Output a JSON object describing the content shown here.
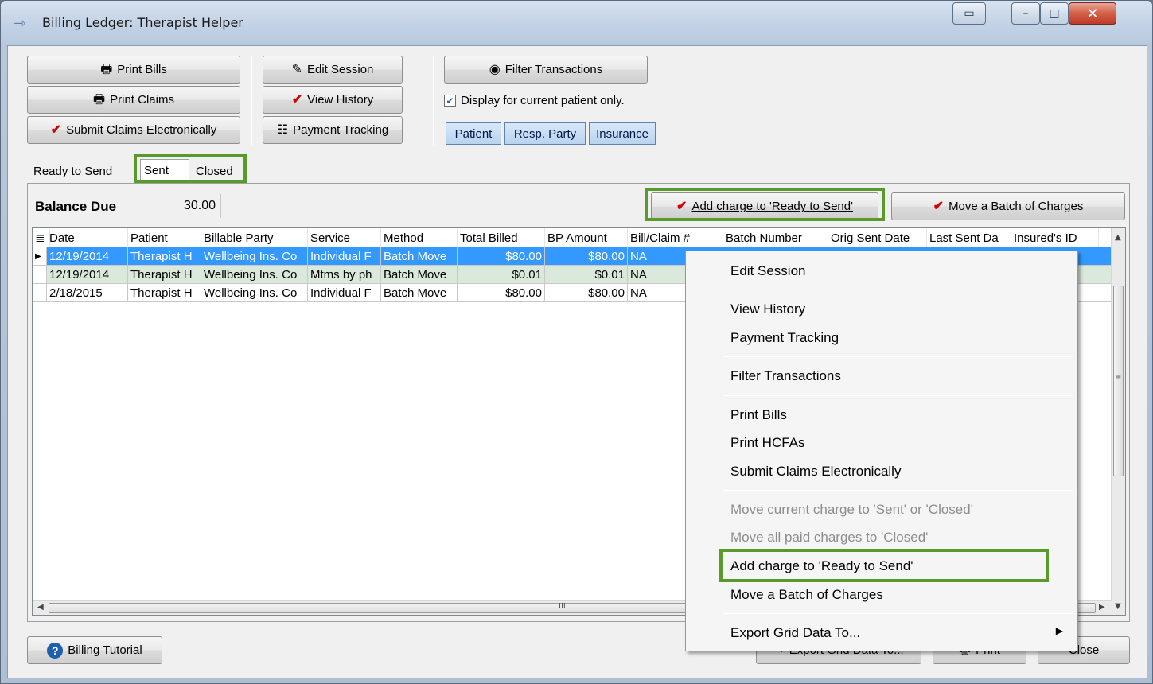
{
  "window": {
    "title": "Billing Ledger: Therapist Helper"
  },
  "toolbar": {
    "print_bills": "Print Bills",
    "print_claims": "Print Claims",
    "submit_claims": "Submit Claims Electronically",
    "edit_session": "Edit Session",
    "view_history": "View History",
    "payment_tracking": "Payment Tracking",
    "filter_transactions": "Filter Transactions",
    "display_current_label": "Display for current patient only.",
    "display_current_checked": true,
    "party_buttons": [
      "Patient",
      "Resp. Party",
      "Insurance"
    ]
  },
  "tabs": [
    "Ready to Send",
    "Sent",
    "Closed"
  ],
  "active_tab": "Sent",
  "balance": {
    "label": "Balance Due",
    "value": "30.00"
  },
  "actions": {
    "add_charge": "Add charge to 'Ready to Send'",
    "move_batch": "Move a Batch of Charges"
  },
  "grid": {
    "columns": [
      "Date",
      "Patient",
      "Billable Party",
      "Service",
      "Method",
      "Total Billed",
      "BP Amount",
      "Bill/Claim #",
      "Batch Number",
      "Orig Sent Date",
      "Last Sent Da",
      "Insured's ID"
    ],
    "rows": [
      [
        "12/19/2014",
        "Therapist H",
        "Wellbeing Ins. Co",
        "Individual F",
        "Batch Move",
        "$80.00",
        "$80.00",
        "NA",
        "",
        "",
        "",
        ""
      ],
      [
        "12/19/2014",
        "Therapist H",
        "Wellbeing Ins. Co",
        "Mtms by ph",
        "Batch Move",
        "$0.01",
        "$0.01",
        "NA",
        "",
        "",
        "",
        ""
      ],
      [
        "2/18/2015",
        "Therapist H",
        "Wellbeing Ins. Co",
        "Individual F",
        "Batch Move",
        "$80.00",
        "$80.00",
        "NA",
        "",
        "",
        "",
        ""
      ]
    ],
    "selected_row": 0,
    "hscroll_grip": "III",
    "vscroll_grip": "≡"
  },
  "context_menu": {
    "items": [
      {
        "label": "Edit Session",
        "enabled": true
      },
      {
        "label": "View History",
        "enabled": true
      },
      {
        "label": "Payment Tracking",
        "enabled": true
      },
      {
        "label": "Filter Transactions",
        "enabled": true
      },
      {
        "label": "Print Bills",
        "enabled": true
      },
      {
        "label": "Print HCFAs",
        "enabled": true
      },
      {
        "label": "Submit Claims Electronically",
        "enabled": true
      },
      {
        "label": "Move current charge to 'Sent' or 'Closed'",
        "enabled": false
      },
      {
        "label": "Move all paid charges to 'Closed'",
        "enabled": false
      },
      {
        "label": "Add charge to 'Ready to Send'",
        "enabled": true
      },
      {
        "label": "Move a Batch of Charges",
        "enabled": true
      },
      {
        "label": "Export Grid Data To...",
        "enabled": true
      }
    ]
  },
  "footer": {
    "billing_tutorial": "Billing Tutorial",
    "export_grid": "Export Grid Data To...",
    "print": "Print",
    "close": "Close"
  },
  "colors": {
    "highlight_box": "#5a9a2c",
    "selected_row": "#3399ff",
    "alt_row": "#dbe9dc",
    "check_mark": "#d40000"
  }
}
